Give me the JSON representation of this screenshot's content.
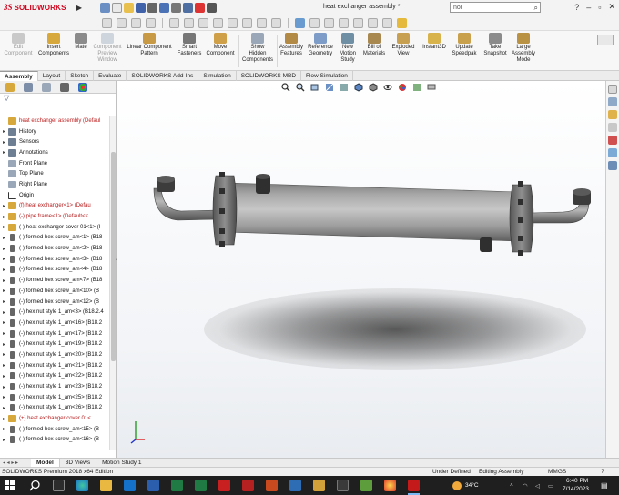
{
  "app": {
    "logo_ds": "3S",
    "logo_text": "SOLIDWORKS",
    "document_title": "heat exchanger assembly *",
    "search_value": "nor"
  },
  "command_manager": [
    {
      "label": "Edit\nComponent",
      "icon": "edit-component-icon",
      "disabled": true
    },
    {
      "label": "Insert\nComponents",
      "icon": "insert-components-icon"
    },
    {
      "label": "Mate",
      "icon": "mate-icon"
    },
    {
      "label": "Component\nPreview\nWindow",
      "icon": "preview-window-icon",
      "disabled": true
    },
    {
      "label": "Linear Component\nPattern",
      "icon": "linear-pattern-icon"
    },
    {
      "label": "Smart\nFasteners",
      "icon": "smart-fasteners-icon"
    },
    {
      "label": "Move\nComponent",
      "icon": "move-component-icon"
    },
    {
      "label": "Show\nHidden\nComponents",
      "icon": "show-hidden-icon"
    },
    {
      "label": "Assembly\nFeatures",
      "icon": "assembly-features-icon"
    },
    {
      "label": "Reference\nGeometry",
      "icon": "reference-geometry-icon"
    },
    {
      "label": "New\nMotion\nStudy",
      "icon": "motion-study-icon"
    },
    {
      "label": "Bill of\nMaterials",
      "icon": "bom-icon"
    },
    {
      "label": "Exploded\nView",
      "icon": "exploded-view-icon"
    },
    {
      "label": "Instant3D",
      "icon": "instant3d-icon"
    },
    {
      "label": "Update\nSpeedpak",
      "icon": "speedpak-icon"
    },
    {
      "label": "Take\nSnapshot",
      "icon": "snapshot-icon"
    },
    {
      "label": "Large\nAssembly\nMode",
      "icon": "large-assembly-icon"
    }
  ],
  "tabs": [
    "Assembly",
    "Layout",
    "Sketch",
    "Evaluate",
    "SOLIDWORKS Add-Ins",
    "Simulation",
    "SOLIDWORKS MBD",
    "Flow Simulation"
  ],
  "active_tab": "Assembly",
  "tree": [
    {
      "label": "heat exchanger assembly  (Defaul",
      "type": "top"
    },
    {
      "label": "History",
      "type": "plain"
    },
    {
      "label": "Sensors",
      "type": "plain"
    },
    {
      "label": "Annotations",
      "type": "plain"
    },
    {
      "label": "Front Plane",
      "type": "plane"
    },
    {
      "label": "Top Plane",
      "type": "plane"
    },
    {
      "label": "Right Plane",
      "type": "plane"
    },
    {
      "label": "Origin",
      "type": "origin"
    },
    {
      "label": "(f) heat exchanger<1> (Defau",
      "type": "red"
    },
    {
      "label": "(-) pipe frame<1> (Default<<",
      "type": "red"
    },
    {
      "label": "(-) heat exchanger cover 01<1> (I",
      "type": "part"
    },
    {
      "label": "(-) formed hex screw_am<1> (B18",
      "type": "screw"
    },
    {
      "label": "(-) formed hex screw_am<2> (B18",
      "type": "screw"
    },
    {
      "label": "(-) formed hex screw_am<3> (B18",
      "type": "screw"
    },
    {
      "label": "(-) formed hex screw_am<4> (B18",
      "type": "screw"
    },
    {
      "label": "(-) formed hex screw_am<7> (B18",
      "type": "screw"
    },
    {
      "label": "(-) formed hex screw_am<10> (B",
      "type": "screw"
    },
    {
      "label": "(-) formed hex screw_am<12> (B",
      "type": "screw"
    },
    {
      "label": "(-) hex nut style 1_am<3> (B18.2.4",
      "type": "screw"
    },
    {
      "label": "(-) hex nut style 1_am<16> (B18.2",
      "type": "screw"
    },
    {
      "label": "(-) hex nut style 1_am<17> (B18.2",
      "type": "screw"
    },
    {
      "label": "(-) hex nut style 1_am<19> (B18.2",
      "type": "screw"
    },
    {
      "label": "(-) hex nut style 1_am<20> (B18.2",
      "type": "screw"
    },
    {
      "label": "(-) hex nut style 1_am<21> (B18.2",
      "type": "screw"
    },
    {
      "label": "(-) hex nut style 1_am<22> (B18.2",
      "type": "screw"
    },
    {
      "label": "(-) hex nut style 1_am<23> (B18.2",
      "type": "screw"
    },
    {
      "label": "(-) hex nut style 1_am<25> (B18.2",
      "type": "screw"
    },
    {
      "label": "(-) hex nut style 1_am<26> (B18.2",
      "type": "screw"
    },
    {
      "label": "(+) heat exchanger cover 01<",
      "type": "red"
    },
    {
      "label": "(-) formed hex screw_am<15> (B",
      "type": "screw"
    },
    {
      "label": "(-) formed hex screw_am<16> (B",
      "type": "screw"
    }
  ],
  "bottom_tabs": [
    "Model",
    "3D Views",
    "Motion Study 1"
  ],
  "active_bottom_tab": "Model",
  "status": {
    "edition": "SOLIDWORKS Premium 2018 x64 Edition",
    "definition": "Under Defined",
    "mode": "Editing Assembly",
    "units": "MMGS"
  },
  "taskbar": {
    "weather": "34°C",
    "time": "6:40 PM",
    "date": "7/14/2023"
  },
  "colors": {
    "brand_red": "#d0021b",
    "taskbar": "#1f1f1f"
  }
}
